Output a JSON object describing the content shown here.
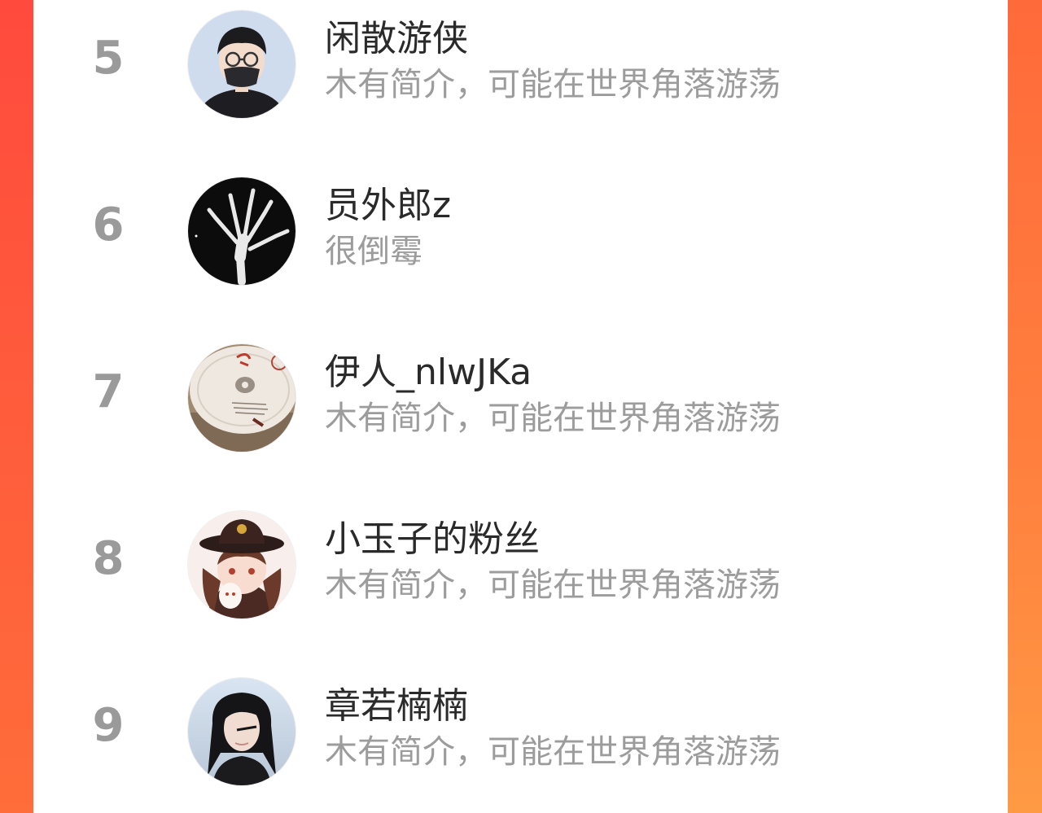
{
  "colors": {
    "background_left": "#ff4a3d",
    "background_right": "#ff8a40",
    "card": "#ffffff",
    "rank_text": "#9a9a9a",
    "name_text": "#2a2a2a",
    "bio_text": "#9c9c9c"
  },
  "ranking": {
    "entries": [
      {
        "rank": "5",
        "name": "闲散游侠",
        "bio": "木有简介，可能在世界角落游荡",
        "avatar_icon": "cartoon-boy-glasses-avatar"
      },
      {
        "rank": "6",
        "name": "员外郎z",
        "bio": "很倒霉",
        "avatar_icon": "xray-hand-avatar"
      },
      {
        "rank": "7",
        "name": "伊人_nlwJKa",
        "bio": "木有简介，可能在世界角落游荡",
        "avatar_icon": "porcelain-plate-avatar"
      },
      {
        "rank": "8",
        "name": "小玉子的粉丝",
        "bio": "木有简介，可能在世界角落游荡",
        "avatar_icon": "anime-girl-hat-avatar"
      },
      {
        "rank": "9",
        "name": "章若楠楠",
        "bio": "木有简介，可能在世界角落游荡",
        "avatar_icon": "photo-girl-avatar"
      }
    ]
  }
}
